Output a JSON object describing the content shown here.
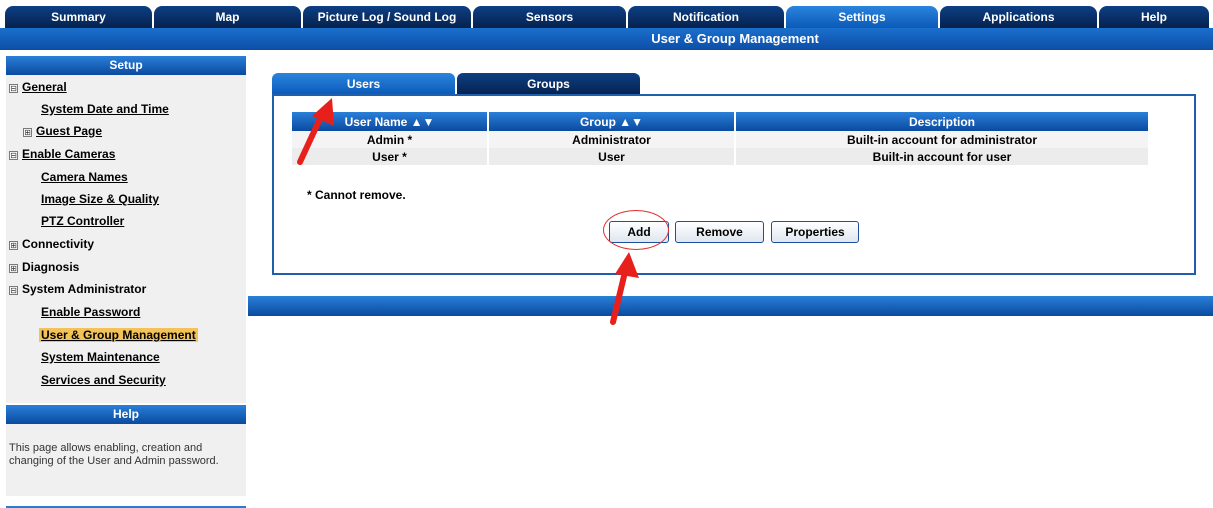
{
  "nav": {
    "tabs": [
      "Summary",
      "Map",
      "Picture Log / Sound Log",
      "Sensors",
      "Notification",
      "Settings",
      "Applications",
      "Help"
    ],
    "active": "Settings"
  },
  "header": {
    "title": "User & Group Management"
  },
  "sidebar": {
    "setup_heading": "Setup",
    "items": [
      {
        "label": "General",
        "toggle": "⊟"
      },
      {
        "label": "System Date and Time"
      },
      {
        "label": "Guest Page",
        "toggle": "⊞"
      },
      {
        "label": "Enable Cameras",
        "toggle": "⊟"
      },
      {
        "label": "Camera Names"
      },
      {
        "label": "Image Size & Quality"
      },
      {
        "label": "PTZ Controller"
      },
      {
        "label": "Connectivity",
        "toggle": "⊞"
      },
      {
        "label": "Diagnosis",
        "toggle": "⊞"
      },
      {
        "label": "System Administrator",
        "toggle": "⊟"
      },
      {
        "label": "Enable Password"
      },
      {
        "label": "User & Group Management",
        "selected": true
      },
      {
        "label": "System Maintenance"
      },
      {
        "label": "Services and Security"
      }
    ],
    "help_heading": "Help",
    "help_text": "This page allows enabling, creation and changing of the User and Admin password."
  },
  "main": {
    "tabs": {
      "users": "Users",
      "groups": "Groups"
    },
    "active_tab": "Users",
    "table": {
      "columns": [
        "User Name ▲▼",
        "Group ▲▼",
        "Description"
      ],
      "rows": [
        [
          "Admin *",
          "Administrator",
          "Built-in account for administrator"
        ],
        [
          "User *",
          "User",
          "Built-in account for user"
        ]
      ]
    },
    "note": "* Cannot remove.",
    "buttons": {
      "add": "Add",
      "remove": "Remove",
      "properties": "Properties"
    }
  },
  "colors": {
    "accent": "#0b5ab8",
    "nav_dark": "#05224d",
    "annotation": "#e8201c",
    "selection": "#f3c35a"
  }
}
